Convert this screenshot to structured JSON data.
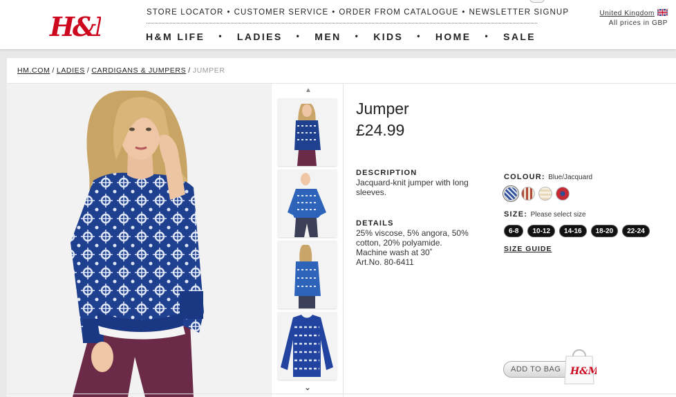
{
  "brand": {
    "logo_text": "H&M"
  },
  "util_nav": [
    "STORE LOCATOR",
    "CUSTOMER SERVICE",
    "ORDER FROM CATALOGUE",
    "NEWSLETTER SIGNUP"
  ],
  "main_nav": [
    "H&M LIFE",
    "LADIES",
    "MEN",
    "KIDS",
    "HOME",
    "SALE"
  ],
  "region": {
    "country": "United Kingdom",
    "currency_note": "All prices in GBP"
  },
  "breadcrumb": [
    "HM.COM",
    "LADIES",
    "CARDIGANS & JUMPERS",
    "JUMPER"
  ],
  "product": {
    "title": "Jumper",
    "price": "£24.99",
    "description_label": "DESCRIPTION",
    "description": "Jacquard-knit jumper with long sleeves.",
    "details_label": "DETAILS",
    "details": [
      "25% viscose, 5% angora, 50% cotton, 20% polyamide.",
      "Machine wash at 30˚",
      "Art.No. 80-6411"
    ],
    "colour_label": "COLOUR:",
    "colour_value": "Blue/Jacquard",
    "swatches": [
      {
        "name": "blue-jacquard",
        "color": "#2f4f9a"
      },
      {
        "name": "red-cream-pattern",
        "color": "#b24a3b"
      },
      {
        "name": "cream-pattern",
        "color": "#e8d9b8"
      },
      {
        "name": "red-blue-pattern",
        "color": "#c42a34"
      }
    ],
    "size_label": "SIZE:",
    "size_hint": "Please select size",
    "sizes": [
      "6-8",
      "10-12",
      "14-16",
      "18-20",
      "22-24"
    ],
    "size_guide": "SIZE GUIDE",
    "add_to_bag": "ADD TO BAG"
  },
  "colors": {
    "brand_red": "#cc071e",
    "jumper_blue": "#1f3f8f"
  }
}
